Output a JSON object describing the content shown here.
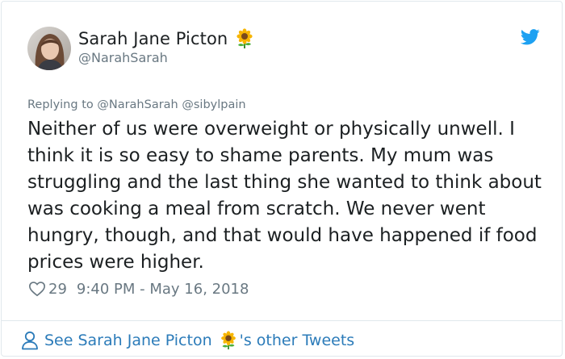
{
  "tweet": {
    "author": {
      "display_name": "Sarah Jane Picton",
      "handle": "@NarahSarah",
      "name_emoji_icon": "sunflower-icon"
    },
    "platform_icon": "twitter-bird-icon",
    "replying_to": "Replying to @NarahSarah @sibylpain",
    "text": "Neither of us were overweight or physically unwell. I think it is so easy to shame parents. My mum was struggling and the last thing she wanted to think about was cooking a meal from scratch. We never went hungry, though, and that would have happened if food prices were higher.",
    "likes": "29",
    "timestamp": "9:40 PM - May 16, 2018"
  },
  "footer": {
    "prefix": "See Sarah Jane Picton",
    "suffix": "'s other Tweets"
  },
  "colors": {
    "text": "#1c2022",
    "muted": "#697882",
    "link": "#2b7bb9",
    "twitter_blue": "#1da1f2",
    "border": "#e1e8ed"
  }
}
